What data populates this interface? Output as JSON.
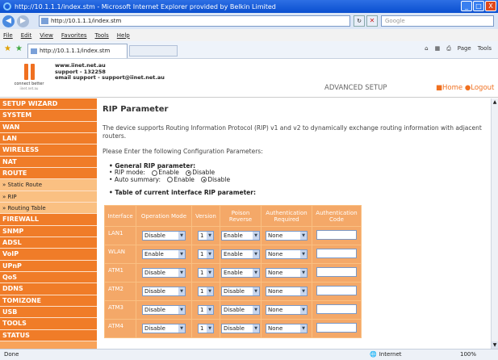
{
  "window": {
    "title": "http://10.1.1.1/index.stm - Microsoft Internet Explorer provided by Belkin Limited",
    "minimize": "_",
    "maximize": "□",
    "close": "X"
  },
  "addressbar": {
    "url": "http://10.1.1.1/index.stm",
    "search_placeholder": "Google",
    "refresh": "↻",
    "stop": "✕"
  },
  "menu": [
    "File",
    "Edit",
    "View",
    "Favorites",
    "Tools",
    "Help"
  ],
  "tab": {
    "title": "http://10.1.1.1/index.stm"
  },
  "toolbar": {
    "page": "Page",
    "tools": "Tools"
  },
  "header": {
    "logo_tagline": "connect better",
    "logo_site": "iinet.net.au",
    "site": "www.iinet.net.au",
    "support": "support - 132258",
    "email": "email support - support@iinet.net.au",
    "advanced_setup": "ADVANCED SETUP",
    "home": "■Home",
    "logout": "●Logout"
  },
  "sidebar": [
    {
      "label": "SETUP WIZARD",
      "sub": false
    },
    {
      "label": "SYSTEM",
      "sub": false
    },
    {
      "label": "WAN",
      "sub": false
    },
    {
      "label": "LAN",
      "sub": false
    },
    {
      "label": "WIRELESS",
      "sub": false
    },
    {
      "label": "NAT",
      "sub": false
    },
    {
      "label": "ROUTE",
      "sub": false
    },
    {
      "label": "» Static Route",
      "sub": true
    },
    {
      "label": "» RIP",
      "sub": true
    },
    {
      "label": "» Routing Table",
      "sub": true
    },
    {
      "label": "FIREWALL",
      "sub": false
    },
    {
      "label": "SNMP",
      "sub": false
    },
    {
      "label": "ADSL",
      "sub": false
    },
    {
      "label": "VoIP",
      "sub": false
    },
    {
      "label": "UPnP",
      "sub": false
    },
    {
      "label": "QoS",
      "sub": false
    },
    {
      "label": "DDNS",
      "sub": false
    },
    {
      "label": "TOMIZONE",
      "sub": false
    },
    {
      "label": "USB",
      "sub": false
    },
    {
      "label": "TOOLS",
      "sub": false
    },
    {
      "label": "STATUS",
      "sub": false
    }
  ],
  "main": {
    "title": "RIP Parameter",
    "description": "The device supports Routing Information Protocol (RIP) v1 and v2 to dynamically exchange routing information with adjacent routers.",
    "instruction": "Please Enter the following Configuration Parameters:",
    "general_heading": "General RIP parameter:",
    "rip_mode_label": "RIP mode:",
    "auto_summary_label": "Auto summary:",
    "enable_label": "Enable",
    "disable_label": "Disable",
    "rip_mode_value": "Disable",
    "auto_summary_value": "Disable",
    "table_heading": "Table of current interface RIP parameter:",
    "table_headers": [
      "Interface",
      "Operation Mode",
      "Version",
      "Poison Reverse",
      "Authentication Required",
      "Authentication Code"
    ],
    "rows": [
      {
        "interface": "LAN1",
        "mode": "Disable",
        "version": "1",
        "poison": "Enable",
        "auth": "None",
        "code": ""
      },
      {
        "interface": "WLAN",
        "mode": "Enable",
        "version": "1",
        "poison": "Enable",
        "auth": "None",
        "code": ""
      },
      {
        "interface": "ATM1",
        "mode": "Disable",
        "version": "1",
        "poison": "Enable",
        "auth": "None",
        "code": ""
      },
      {
        "interface": "ATM2",
        "mode": "Disable",
        "version": "1",
        "poison": "Disable",
        "auth": "None",
        "code": ""
      },
      {
        "interface": "ATM3",
        "mode": "Disable",
        "version": "1",
        "poison": "Disable",
        "auth": "None",
        "code": ""
      },
      {
        "interface": "ATM4",
        "mode": "Disable",
        "version": "1",
        "poison": "Disable",
        "auth": "None",
        "code": ""
      }
    ]
  },
  "status": {
    "left": "Done",
    "zone": "Internet",
    "zoom": "100%"
  },
  "colors": {
    "sidebar": "#f07c28",
    "sidebar_sub": "#fac082",
    "table": "#f4a868",
    "accent": "#f07020"
  }
}
